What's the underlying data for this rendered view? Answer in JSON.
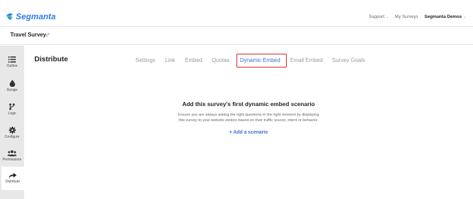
{
  "app": {
    "brand_name": "Segmanta",
    "brand_color": "#2c7be5"
  },
  "top_nav": {
    "support_label": "Support",
    "my_surveys_label": "My Surveys",
    "org_label": "Segmanta Demos"
  },
  "survey": {
    "title": "Travel Survey"
  },
  "sidebar": {
    "items": [
      {
        "label": "Outline",
        "icon": "list-icon"
      },
      {
        "label": "Design",
        "icon": "droplet-icon"
      },
      {
        "label": "Logic",
        "icon": "branch-icon"
      },
      {
        "label": "Configure",
        "icon": "gear-icon"
      },
      {
        "label": "Permissions",
        "icon": "users-icon"
      },
      {
        "label": "Distribute",
        "icon": "share-icon",
        "active": true
      }
    ]
  },
  "page": {
    "heading": "Distribute"
  },
  "tabs": [
    {
      "label": "Settings"
    },
    {
      "label": "Link"
    },
    {
      "label": "Embed"
    },
    {
      "label": "Quotas"
    },
    {
      "label": "Dynamic Embed",
      "selected": true
    },
    {
      "label": "Email Embed"
    },
    {
      "label": "Survey Goals"
    }
  ],
  "empty_state": {
    "title": "Add this survey's first dynamic embed scenario",
    "description_line1": "Ensure you are always asking the right questions in the right moment by displaying",
    "description_line2": "this survey to your website visitors based on their traffic source, intent or behavior.",
    "add_label": "+ Add a scenario"
  },
  "colors": {
    "accent": "#3b6fd6",
    "highlight": "#d62020",
    "sidebar_bg": "#e8e8e8"
  }
}
